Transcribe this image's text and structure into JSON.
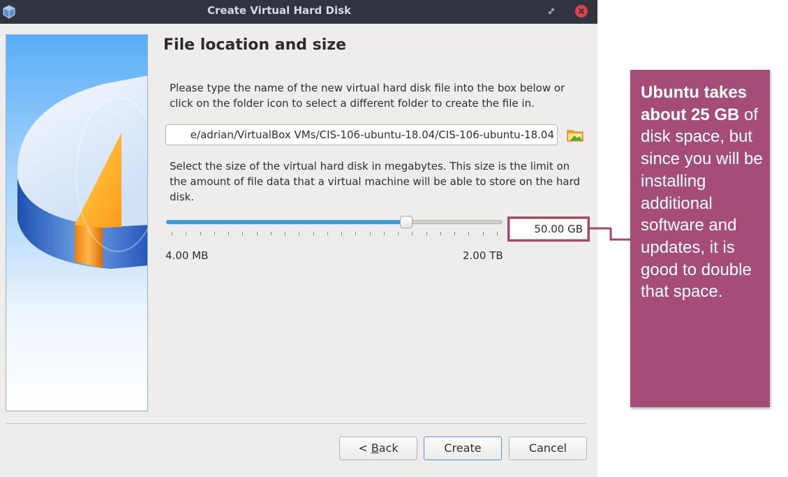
{
  "window": {
    "title": "Create Virtual Hard Disk"
  },
  "page": {
    "title": "File location and size",
    "location_description": "Please type the name of the new virtual hard disk file into the box below or click on the folder icon to select a different folder to create the file in.",
    "file_path": "e/adrian/VirtualBox VMs/CIS-106-ubuntu-18.04/CIS-106-ubuntu-18.04",
    "size_description": "Select the size of the virtual hard disk in megabytes. This size is the limit on the amount of file data that a virtual machine will be able to store on the hard disk.",
    "slider": {
      "value_fraction": 0.71,
      "min_label": "4.00 MB",
      "max_label": "2.00 TB"
    },
    "size_value": "50.00 GB"
  },
  "buttons": {
    "back_prefix": "< ",
    "back_mnemonic": "B",
    "back_rest": "ack",
    "create": "Create",
    "cancel": "Cancel"
  },
  "callout": {
    "bold_text": "Ubuntu takes about 25 GB",
    "rest_text": " of disk space, but since you will be installing additional software and updates, it is good to double that space."
  },
  "icons": {
    "app": "virtualbox-icon",
    "restore": "restore-icon",
    "close": "close-icon",
    "folder": "folder-icon"
  },
  "colors": {
    "titlebar": "#2f343f",
    "accent": "#5294e2",
    "slider_fill": "#3e9ad8",
    "callout": "#a54c77",
    "close": "#e14245"
  }
}
